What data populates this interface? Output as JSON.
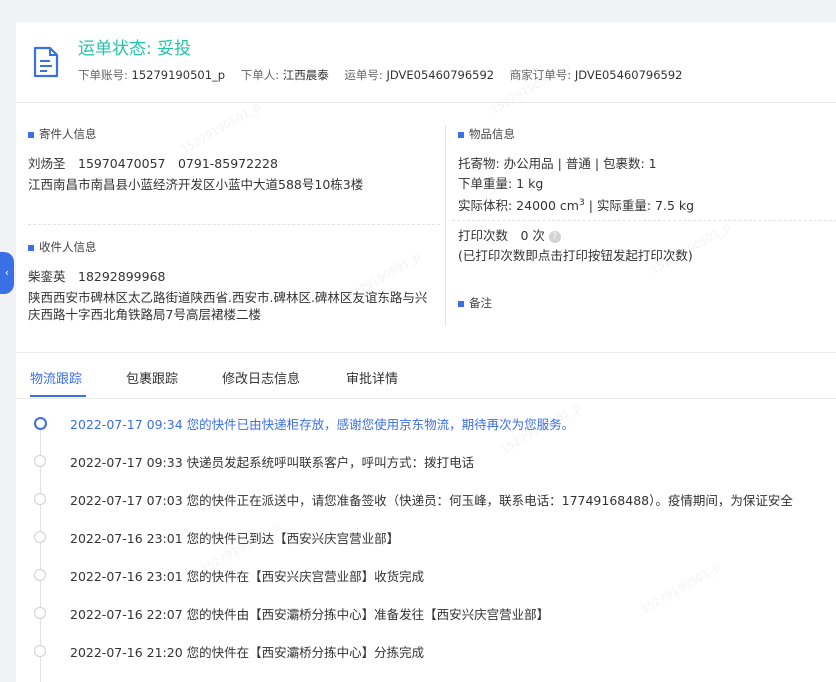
{
  "header": {
    "status": "运单状态: 妥投",
    "meta": [
      {
        "key": "下单账号:",
        "value": "15279190501_p"
      },
      {
        "key": "下单人:",
        "value": "江西晨泰"
      },
      {
        "key": "运单号:",
        "value": "JDVE05460796592"
      },
      {
        "key": "商家订单号:",
        "value": "JDVE05460796592"
      }
    ]
  },
  "sender": {
    "title": "寄件人信息",
    "line1": "刘炀圣　15970470057　0791-85972228",
    "address": "江西南昌市南昌县小蓝经济开发区小蓝中大道588号10栋3楼"
  },
  "receiver": {
    "title": "收件人信息",
    "line1": "柴銮英　18292899968",
    "address": "陕西西安市碑林区太乙路街道陕西省.西安市.碑林区.碑林区友谊东路与兴庆西路十字西北角铁路局7号高层裙楼二楼"
  },
  "goods": {
    "title": "物品信息",
    "line1": "托寄物:  办公用品 | 普通  |  包裹数:  1",
    "line2": "下单重量:  1 kg",
    "volume_label": "实际体积:  24000 cm",
    "volume_sup": "3",
    "volume_rest": " | 实际重量:  7.5 kg",
    "print_label": "打印次数　0 次",
    "print_note": "(已打印次数即点击打印按钮发起打印次数)"
  },
  "remark": {
    "title": "备注"
  },
  "tabs": [
    {
      "label": "物流跟踪",
      "active": true
    },
    {
      "label": "包裹跟踪"
    },
    {
      "label": "修改日志信息"
    },
    {
      "label": "审批详情"
    }
  ],
  "timeline": [
    {
      "text": "2022-07-17 09:34  您的快件已由快递柜存放，感谢您使用京东物流，期待再次为您服务。",
      "current": true
    },
    {
      "text": "2022-07-17 09:33  快递员发起系统呼叫联系客户，呼叫方式：拨打电话"
    },
    {
      "text": "2022-07-17 07:03  您的快件正在派送中，请您准备签收（快递员：何玉峰，联系电话：17749168488）。疫情期间，为保证安全"
    },
    {
      "text": "2022-07-16 23:01  您的快件已到达【西安兴庆宫营业部】"
    },
    {
      "text": "2022-07-16 23:01  您的快件在【西安兴庆宫营业部】收货完成"
    },
    {
      "text": "2022-07-16 22:07  您的快件由【西安灞桥分拣中心】准备发往【西安兴庆宫营业部】"
    },
    {
      "text": "2022-07-16 21:20  您的快件在【西安灞桥分拣中心】分拣完成"
    }
  ],
  "colors": {
    "accent": "#3b6fe6",
    "status": "#1fc5a8"
  },
  "watermark": "15279190501_p"
}
